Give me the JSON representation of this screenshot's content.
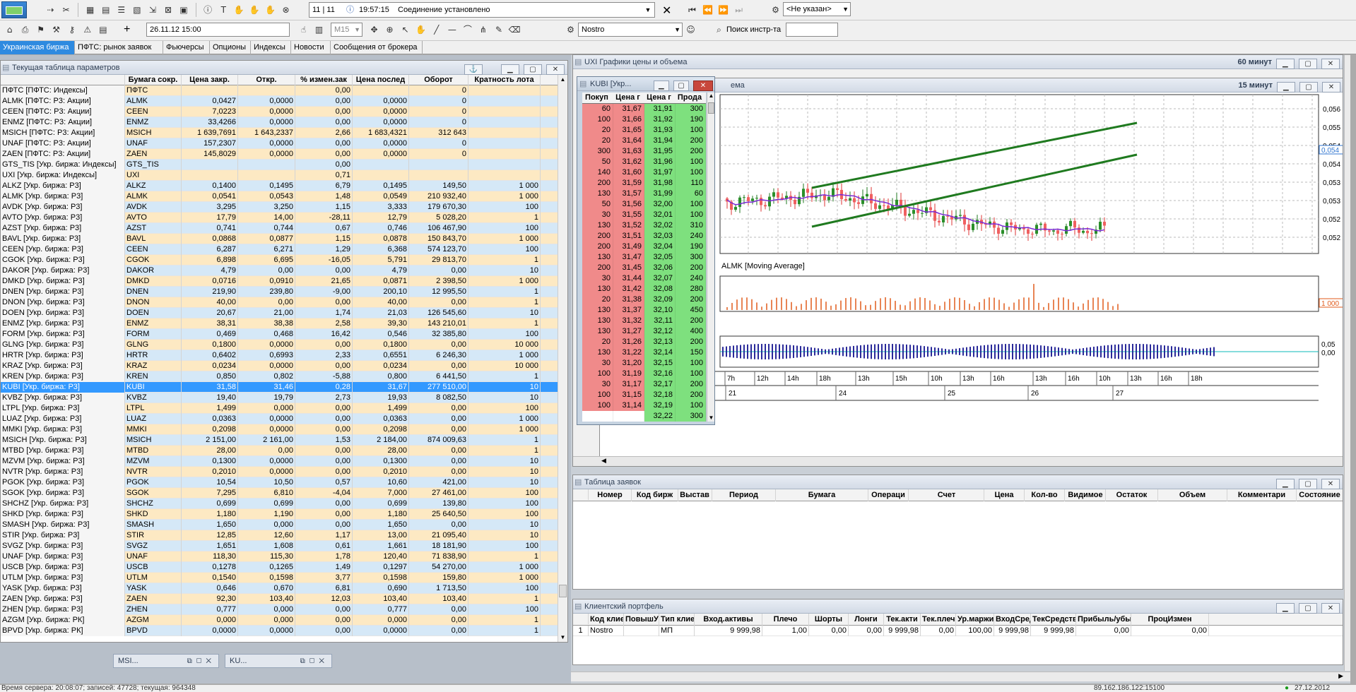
{
  "toolbar1": {
    "counter": "11 | 11",
    "message_time": "19:57:15",
    "message": "Соединение установлено",
    "broker_select": "<Не указан>"
  },
  "toolbar2": {
    "add": "+",
    "date": "26.11.12 15:00",
    "interval": "M15",
    "account": "Nostro",
    "search_label": "Поиск инстр-та",
    "search_value": ""
  },
  "tabs": [
    "Украинская биржа",
    "ПФТС: рынок заявок",
    "Фьючерсы",
    "Опционы",
    "Индексы",
    "Новости",
    "Сообщения от брокера"
  ],
  "params_window": {
    "title": "Текущая таблица параметров",
    "columns": [
      "",
      "Бумага сокр.",
      "Цена закр.",
      "Откр.",
      "% измен.зак",
      "Цена послед",
      "Оборот",
      "Кратность лота"
    ],
    "rows": [
      [
        "ПФТС [ПФТС: Индексы]",
        "ПФТС",
        "",
        "",
        "0,00",
        "",
        "0",
        ""
      ],
      [
        "ALMK [ПФТС: Р3: Акции]",
        "ALMK",
        "0,0427",
        "0,0000",
        "0,00",
        "0,0000",
        "0",
        ""
      ],
      [
        "CEEN [ПФТС: Р3: Акции]",
        "CEEN",
        "7,0223",
        "0,0000",
        "0,00",
        "0,0000",
        "0",
        ""
      ],
      [
        "ENMZ [ПФТС: Р3: Акции]",
        "ENMZ",
        "33,4266",
        "0,0000",
        "0,00",
        "0,0000",
        "0",
        ""
      ],
      [
        "MSICH [ПФТС: Р3: Акции]",
        "MSICH",
        "1 639,7691",
        "1 643,2337",
        "2,66",
        "1 683,4321",
        "312 643",
        ""
      ],
      [
        "UNAF [ПФТС: Р3: Акции]",
        "UNAF",
        "157,2307",
        "0,0000",
        "0,00",
        "0,0000",
        "0",
        ""
      ],
      [
        "ZAEN [ПФТС: Р3: Акции]",
        "ZAEN",
        "145,8029",
        "0,0000",
        "0,00",
        "0,0000",
        "0",
        ""
      ],
      [
        "GTS_TIS [Укр. биржа: Индексы]",
        "GTS_TIS",
        "",
        "",
        "0,00",
        "",
        "",
        ""
      ],
      [
        "UXI [Укр. биржа: Индексы]",
        "UXI",
        "",
        "",
        "0,71",
        "",
        "",
        ""
      ],
      [
        "ALKZ [Укр. биржа: Р3]",
        "ALKZ",
        "0,1400",
        "0,1495",
        "6,79",
        "0,1495",
        "149,50",
        "1 000"
      ],
      [
        "ALMK [Укр. биржа: Р3]",
        "ALMK",
        "0,0541",
        "0,0543",
        "1,48",
        "0,0549",
        "210 932,40",
        "1 000"
      ],
      [
        "AVDK [Укр. биржа: Р3]",
        "AVDK",
        "3,295",
        "3,250",
        "1,15",
        "3,333",
        "179 670,30",
        "100"
      ],
      [
        "AVTO [Укр. биржа: Р3]",
        "AVTO",
        "17,79",
        "14,00",
        "-28,11",
        "12,79",
        "5 028,20",
        "1"
      ],
      [
        "AZST [Укр. биржа: Р3]",
        "AZST",
        "0,741",
        "0,744",
        "0,67",
        "0,746",
        "106 467,90",
        "100"
      ],
      [
        "BAVL [Укр. биржа: Р3]",
        "BAVL",
        "0,0868",
        "0,0877",
        "1,15",
        "0,0878",
        "150 843,70",
        "1 000"
      ],
      [
        "CEEN [Укр. биржа: Р3]",
        "CEEN",
        "6,287",
        "6,271",
        "1,29",
        "6,368",
        "574 123,70",
        "100"
      ],
      [
        "CGOK [Укр. биржа: Р3]",
        "CGOK",
        "6,898",
        "6,695",
        "-16,05",
        "5,791",
        "29 813,70",
        "1"
      ],
      [
        "DAKOR [Укр. биржа: Р3]",
        "DAKOR",
        "4,79",
        "0,00",
        "0,00",
        "4,79",
        "0,00",
        "10"
      ],
      [
        "DMKD [Укр. биржа: Р3]",
        "DMKD",
        "0,0716",
        "0,0910",
        "21,65",
        "0,0871",
        "2 398,50",
        "1 000"
      ],
      [
        "DNEN [Укр. биржа: Р3]",
        "DNEN",
        "219,90",
        "239,80",
        "-9,00",
        "200,10",
        "12 995,50",
        "1"
      ],
      [
        "DNON [Укр. биржа: Р3]",
        "DNON",
        "40,00",
        "0,00",
        "0,00",
        "40,00",
        "0,00",
        "1"
      ],
      [
        "DOEN [Укр. биржа: Р3]",
        "DOEN",
        "20,67",
        "21,00",
        "1,74",
        "21,03",
        "126 545,60",
        "10"
      ],
      [
        "ENMZ [Укр. биржа: Р3]",
        "ENMZ",
        "38,31",
        "38,38",
        "2,58",
        "39,30",
        "143 210,01",
        "1"
      ],
      [
        "FORM [Укр. биржа: Р3]",
        "FORM",
        "0,469",
        "0,468",
        "16,42",
        "0,546",
        "32 385,80",
        "100"
      ],
      [
        "GLNG [Укр. биржа: Р3]",
        "GLNG",
        "0,1800",
        "0,0000",
        "0,00",
        "0,1800",
        "0,00",
        "10 000"
      ],
      [
        "HRTR [Укр. биржа: Р3]",
        "HRTR",
        "0,6402",
        "0,6993",
        "2,33",
        "0,6551",
        "6 246,30",
        "1 000"
      ],
      [
        "KRAZ [Укр. биржа: Р3]",
        "KRAZ",
        "0,0234",
        "0,0000",
        "0,00",
        "0,0234",
        "0,00",
        "10 000"
      ],
      [
        "KREN [Укр. биржа: Р3]",
        "KREN",
        "0,850",
        "0,802",
        "-5,88",
        "0,800",
        "6 441,50",
        "1"
      ],
      [
        "KUBI [Укр. биржа: Р3]",
        "KUBI",
        "31,58",
        "31,46",
        "0,28",
        "31,67",
        "277 510,00",
        "10"
      ],
      [
        "KVBZ [Укр. биржа: Р3]",
        "KVBZ",
        "19,40",
        "19,79",
        "2,73",
        "19,93",
        "8 082,50",
        "10"
      ],
      [
        "LTPL [Укр. биржа: Р3]",
        "LTPL",
        "1,499",
        "0,000",
        "0,00",
        "1,499",
        "0,00",
        "100"
      ],
      [
        "LUAZ [Укр. биржа: Р3]",
        "LUAZ",
        "0,0363",
        "0,0000",
        "0,00",
        "0,0363",
        "0,00",
        "1 000"
      ],
      [
        "MMKI [Укр. биржа: Р3]",
        "MMKI",
        "0,2098",
        "0,0000",
        "0,00",
        "0,2098",
        "0,00",
        "1 000"
      ],
      [
        "MSICH [Укр. биржа: Р3]",
        "MSICH",
        "2 151,00",
        "2 161,00",
        "1,53",
        "2 184,00",
        "874 009,63",
        "1"
      ],
      [
        "MTBD [Укр. биржа: Р3]",
        "MTBD",
        "28,00",
        "0,00",
        "0,00",
        "28,00",
        "0,00",
        "1"
      ],
      [
        "MZVM [Укр. биржа: Р3]",
        "MZVM",
        "0,1300",
        "0,0000",
        "0,00",
        "0,1300",
        "0,00",
        "10"
      ],
      [
        "NVTR [Укр. биржа: Р3]",
        "NVTR",
        "0,2010",
        "0,0000",
        "0,00",
        "0,2010",
        "0,00",
        "10"
      ],
      [
        "PGOK [Укр. биржа: Р3]",
        "PGOK",
        "10,54",
        "10,50",
        "0,57",
        "10,60",
        "421,00",
        "10"
      ],
      [
        "SGOK [Укр. биржа: Р3]",
        "SGOK",
        "7,295",
        "6,810",
        "-4,04",
        "7,000",
        "27 461,00",
        "100"
      ],
      [
        "SHCHZ [Укр. биржа: Р3]",
        "SHCHZ",
        "0,699",
        "0,699",
        "0,00",
        "0,699",
        "139,80",
        "100"
      ],
      [
        "SHKD [Укр. биржа: Р3]",
        "SHKD",
        "1,180",
        "1,190",
        "0,00",
        "1,180",
        "25 640,50",
        "100"
      ],
      [
        "SMASH [Укр. биржа: Р3]",
        "SMASH",
        "1,650",
        "0,000",
        "0,00",
        "1,650",
        "0,00",
        "10"
      ],
      [
        "STIR [Укр. биржа: Р3]",
        "STIR",
        "12,85",
        "12,60",
        "1,17",
        "13,00",
        "21 095,40",
        "10"
      ],
      [
        "SVGZ [Укр. биржа: Р3]",
        "SVGZ",
        "1,651",
        "1,608",
        "0,61",
        "1,661",
        "18 181,90",
        "100"
      ],
      [
        "UNAF [Укр. биржа: Р3]",
        "UNAF",
        "118,30",
        "115,30",
        "1,78",
        "120,40",
        "71 838,90",
        "1"
      ],
      [
        "USCB [Укр. биржа: Р3]",
        "USCB",
        "0,1278",
        "0,1265",
        "1,49",
        "0,1297",
        "54 270,00",
        "1 000"
      ],
      [
        "UTLM [Укр. биржа: Р3]",
        "UTLM",
        "0,1540",
        "0,1598",
        "3,77",
        "0,1598",
        "159,80",
        "1 000"
      ],
      [
        "YASK [Укр. биржа: Р3]",
        "YASK",
        "0,646",
        "0,670",
        "6,81",
        "0,690",
        "1 713,50",
        "100"
      ],
      [
        "ZAEN [Укр. биржа: Р3]",
        "ZAEN",
        "92,30",
        "103,40",
        "12,03",
        "103,40",
        "103,40",
        "1"
      ],
      [
        "ZHEN [Укр. биржа: Р3]",
        "ZHEN",
        "0,777",
        "0,000",
        "0,00",
        "0,777",
        "0,00",
        "100"
      ],
      [
        "AZGM [Укр. биржа: РК]",
        "AZGM",
        "0,000",
        "0,000",
        "0,00",
        "0,000",
        "0,00",
        "1"
      ],
      [
        "BPVD [Укр. биржа: РК]",
        "BPVD",
        "0,0000",
        "0,0000",
        "0,00",
        "0,0000",
        "0,00",
        "1"
      ]
    ],
    "selected_row": 28
  },
  "minimized": [
    {
      "label": "MSI..."
    },
    {
      "label": "KU..."
    }
  ],
  "orderbook": {
    "title": "KUBI [Укр...",
    "columns": [
      "Покуп",
      "Цена г",
      "Цена г",
      "Прода"
    ],
    "buy": [
      [
        "60",
        "31,67"
      ],
      [
        "100",
        "31,66"
      ],
      [
        "20",
        "31,65"
      ],
      [
        "20",
        "31,64"
      ],
      [
        "300",
        "31,63"
      ],
      [
        "50",
        "31,62"
      ],
      [
        "140",
        "31,60"
      ],
      [
        "200",
        "31,59"
      ],
      [
        "130",
        "31,57"
      ],
      [
        "50",
        "31,56"
      ],
      [
        "30",
        "31,55"
      ],
      [
        "130",
        "31,52"
      ],
      [
        "200",
        "31,51"
      ],
      [
        "200",
        "31,49"
      ],
      [
        "130",
        "31,47"
      ],
      [
        "200",
        "31,45"
      ],
      [
        "30",
        "31,44"
      ],
      [
        "130",
        "31,42"
      ],
      [
        "20",
        "31,38"
      ],
      [
        "130",
        "31,37"
      ],
      [
        "130",
        "31,32"
      ],
      [
        "130",
        "31,27"
      ],
      [
        "20",
        "31,26"
      ],
      [
        "130",
        "31,22"
      ],
      [
        "30",
        "31,20"
      ],
      [
        "100",
        "31,19"
      ],
      [
        "30",
        "31,17"
      ],
      [
        "100",
        "31,15"
      ],
      [
        "100",
        "31,14"
      ]
    ],
    "sell": [
      [
        "31,91",
        "300"
      ],
      [
        "31,92",
        "190"
      ],
      [
        "31,93",
        "100"
      ],
      [
        "31,94",
        "200"
      ],
      [
        "31,95",
        "200"
      ],
      [
        "31,96",
        "100"
      ],
      [
        "31,97",
        "100"
      ],
      [
        "31,98",
        "110"
      ],
      [
        "31,99",
        "60"
      ],
      [
        "32,00",
        "100"
      ],
      [
        "32,01",
        "100"
      ],
      [
        "32,02",
        "310"
      ],
      [
        "32,03",
        "240"
      ],
      [
        "32,04",
        "190"
      ],
      [
        "32,05",
        "300"
      ],
      [
        "32,06",
        "200"
      ],
      [
        "32,07",
        "240"
      ],
      [
        "32,08",
        "280"
      ],
      [
        "32,09",
        "200"
      ],
      [
        "32,10",
        "450"
      ],
      [
        "32,11",
        "200"
      ],
      [
        "32,12",
        "400"
      ],
      [
        "32,13",
        "200"
      ],
      [
        "32,14",
        "150"
      ],
      [
        "32,15",
        "100"
      ],
      [
        "32,16",
        "100"
      ],
      [
        "32,17",
        "200"
      ],
      [
        "32,18",
        "200"
      ],
      [
        "32,19",
        "100"
      ],
      [
        "32,22",
        "300"
      ]
    ]
  },
  "chart_outer": {
    "title": "UXI Графики цены и объема",
    "interval": "60 минут"
  },
  "chart_inner": {
    "title_tail": "ема",
    "interval": "15 минут"
  },
  "chart_data": {
    "type": "candlestick",
    "price_axis_ticks": [
      "0,056",
      "0,055",
      "0,054",
      "0,054",
      "0,053",
      "0,053",
      "0,052",
      "0,052"
    ],
    "current_price_label": "0,054",
    "indicator_label": "ALMK [Moving Average]",
    "volume_label": "1 000",
    "osc_ticks": [
      "0,05",
      "0,00"
    ],
    "time_labels": [
      "7h",
      "12h",
      "14h",
      "18h",
      "13h",
      "15h",
      "10h",
      "13h",
      "16h",
      "13h",
      "16h",
      "10h",
      "13h",
      "16h",
      "18h"
    ],
    "date_labels": [
      "21",
      "24",
      "25",
      "26",
      "27"
    ]
  },
  "orders_window": {
    "title": "Таблица заявок",
    "columns": [
      "Номер",
      "Код бирж",
      "Выстав",
      "Период",
      "Бумага",
      "Операци",
      "Счет",
      "Цена",
      "Кол-во",
      "Видимое",
      "Остаток",
      "Объем",
      "Комментари",
      "Состояние"
    ]
  },
  "portfolio_window": {
    "title": "Клиентский портфель",
    "columns": [
      "Код клиен",
      "ПовышУр",
      "Тип клиен",
      "Вход.активы",
      "Плечо",
      "Шорты",
      "Лонги",
      "Тек.акти",
      "Тек.плеч",
      "Ур.маржи",
      "ВходСред",
      "ТекСредства",
      "Прибыль/убы",
      "ПроцИзмен"
    ],
    "row_num": "1",
    "row": [
      "Nostro",
      "",
      "МП",
      "9 999,98",
      "1,00",
      "0,00",
      "0,00",
      "9 999,98",
      "0,00",
      "100,00",
      "9 999,98",
      "9 999,98",
      "0,00",
      "0,00"
    ]
  },
  "statusbar": {
    "left": "Время сервера: 20:08:07; записей: 47728; текущая: 964348",
    "ip": "89.162.186.122:15100",
    "date": "27.12.2012"
  }
}
